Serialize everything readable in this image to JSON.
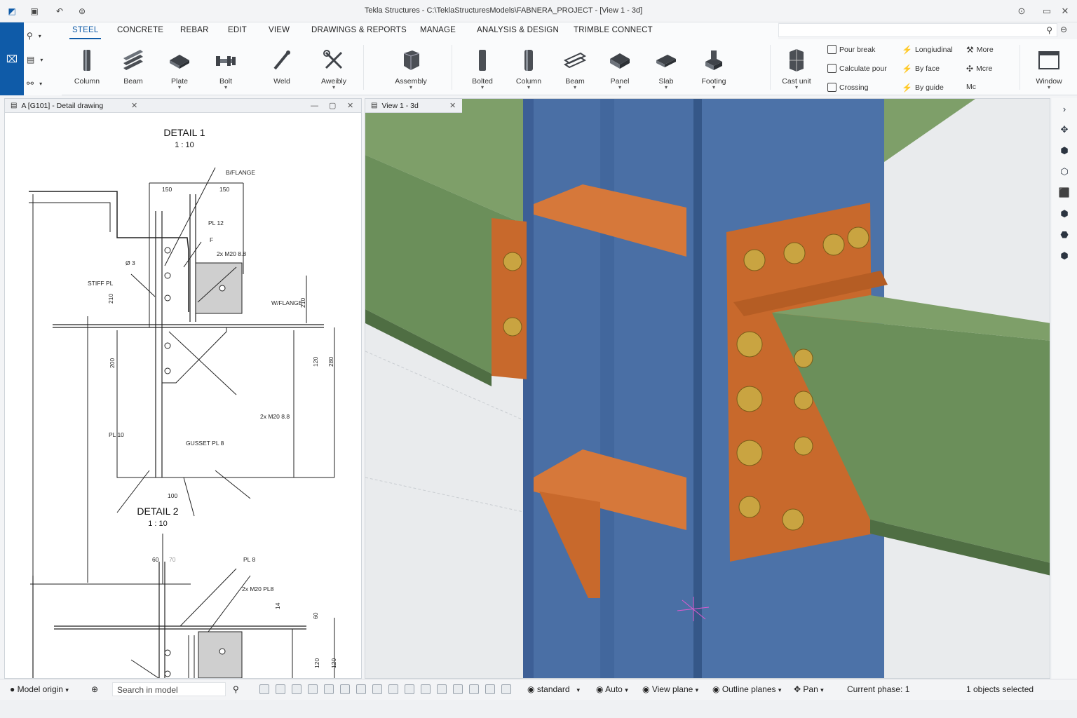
{
  "window": {
    "title": "Tekla Structures - C:\\TeklaStructuresModels\\FABNERA_PROJECT - [View 1 - 3d]"
  },
  "menu_tabs": [
    "STEEL",
    "CONCRETE",
    "REBAR",
    "EDIT",
    "VIEW",
    "DRAWINGS & REPORTS",
    "MANAGE",
    "ANALYSIS & DESIGN",
    "TRIMBLE CONNECT"
  ],
  "active_tab": "STEEL",
  "ribbon": {
    "steel_buttons": [
      "Column",
      "Beam",
      "Plate",
      "Bolt",
      "Weld",
      "Aweibly"
    ],
    "assembly_label": "Assembly",
    "concrete_buttons": [
      "Bolted",
      "Column",
      "Beam",
      "Panel",
      "Slab",
      "Footing"
    ],
    "cast_unit_label": "Cast unit",
    "pour_group": [
      "Pour break",
      "Calculate pour",
      "Crossing"
    ],
    "rebar_group": [
      "Longiudinal",
      "By face",
      "By guide"
    ],
    "more_group": [
      "More",
      "Mcre",
      "Mc"
    ],
    "window_label": "Window"
  },
  "drawing_panel": {
    "tab_label": "A [G101] - Detail drawing",
    "detail1": {
      "title": "DETAIL 1",
      "scale": "1 : 10"
    },
    "detail2": {
      "title": "DETAIL 2",
      "scale": "1 : 10"
    },
    "labels": {
      "biflange": "B/FLANGE",
      "d150a": "150",
      "d150b": "150",
      "pl12": "PL 12",
      "f": "F",
      "bolts1": "2x M20 8.8",
      "stiff": "STIFF PL",
      "d03": "Ø 3",
      "wflange": "W/FLANGE",
      "d210a": "210",
      "d210b": "210",
      "d200": "200",
      "d120": "120",
      "d280": "280",
      "bolts2": "2x M20 8.8",
      "pl10": "PL 10",
      "gusset": "GUSSET PL 8",
      "d100": "100",
      "d60": "60",
      "d70": "70",
      "pl8": "PL 8",
      "bolts3": "2x M20 PL8",
      "d14": "14",
      "d120b": "120",
      "d120c": "120",
      "d60b": "60"
    }
  },
  "view_panel": {
    "tab_label": "View 1 - 3d"
  },
  "status_bar": {
    "origin": "Model origin",
    "search_placeholder": "Search in model",
    "view_style": "standard",
    "auto": "Auto",
    "view_plane": "View plane",
    "outline": "Outline planes",
    "pan": "Pan",
    "phase": "Current phase: 1",
    "selected": "1 objects selected"
  },
  "colors": {
    "accent": "#0f5ba8",
    "steel_column": "#4a6fa5",
    "green_beam": "#6b8f5a",
    "plates": "#c8692c",
    "bolts": "#c9a441"
  }
}
